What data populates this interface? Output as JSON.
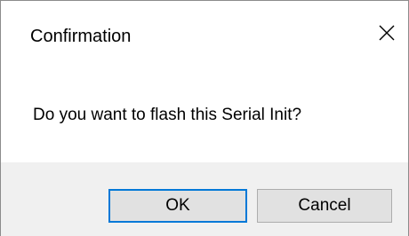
{
  "window": {
    "title": "Confirmation",
    "close_icon": "close-icon"
  },
  "message": {
    "text": "Do you want to flash this Serial Init?"
  },
  "buttons": {
    "ok_label": "OK",
    "cancel_label": "Cancel"
  },
  "colors": {
    "dialog_background": "#ffffff",
    "button_area_background": "#f0f0f0",
    "button_face": "#e1e1e1",
    "default_button_border": "#0078d7"
  }
}
